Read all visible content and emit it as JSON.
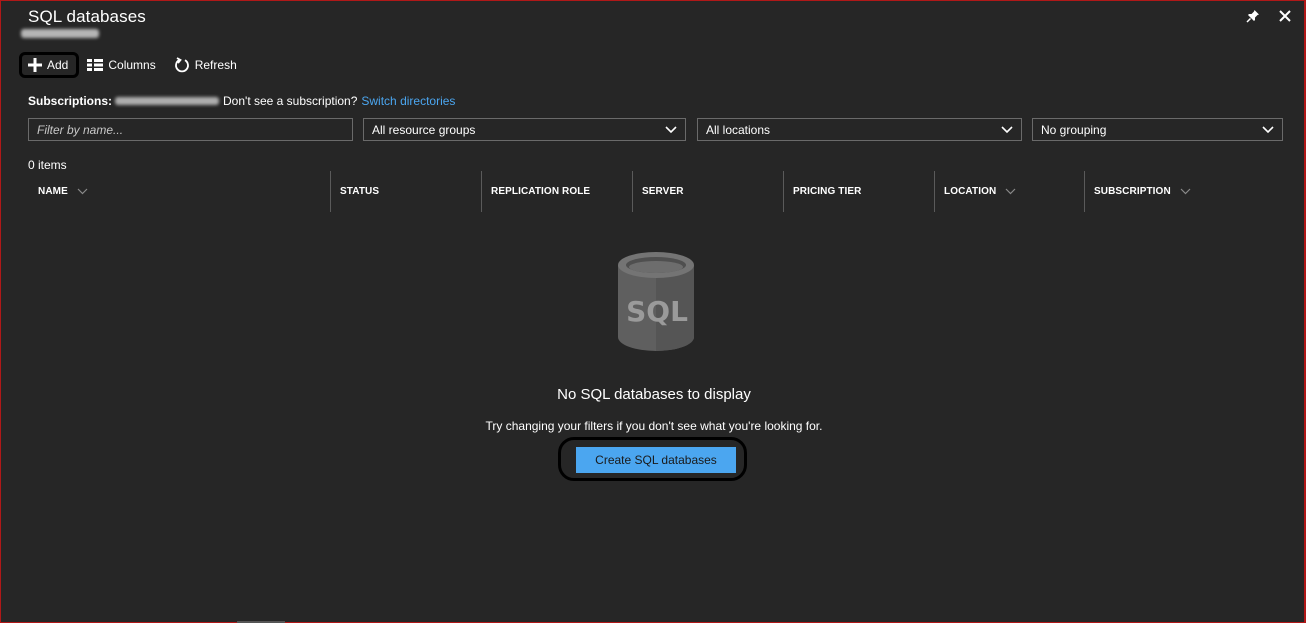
{
  "blade": {
    "title": "SQL databases",
    "subtitle_redacted": true
  },
  "toolbar": {
    "add_label": "Add",
    "columns_label": "Columns",
    "refresh_label": "Refresh"
  },
  "subscriptions": {
    "label": "Subscriptions:",
    "hint": "Don't see a subscription?",
    "link": "Switch directories"
  },
  "filters": {
    "name_placeholder": "Filter by name...",
    "resource_groups": "All resource groups",
    "locations": "All locations",
    "grouping": "No grouping"
  },
  "items_count": "0 items",
  "table": {
    "columns": [
      "NAME",
      "STATUS",
      "REPLICATION ROLE",
      "SERVER",
      "PRICING TIER",
      "LOCATION",
      "SUBSCRIPTION"
    ]
  },
  "empty_state": {
    "icon_text": "SQL",
    "title": "No SQL databases to display",
    "hint": "Try changing your filters if you don't see what you're looking for.",
    "create_label": "Create SQL databases"
  },
  "colors": {
    "background": "#262626",
    "accent": "#4ba6f0",
    "border": "#6a6a6a"
  },
  "icons": {
    "pin": "pin-icon",
    "close": "close-icon",
    "add": "plus-icon",
    "columns": "columns-icon",
    "refresh": "refresh-icon",
    "dropdown": "chevron-down-icon",
    "empty": "sql-database-icon"
  }
}
